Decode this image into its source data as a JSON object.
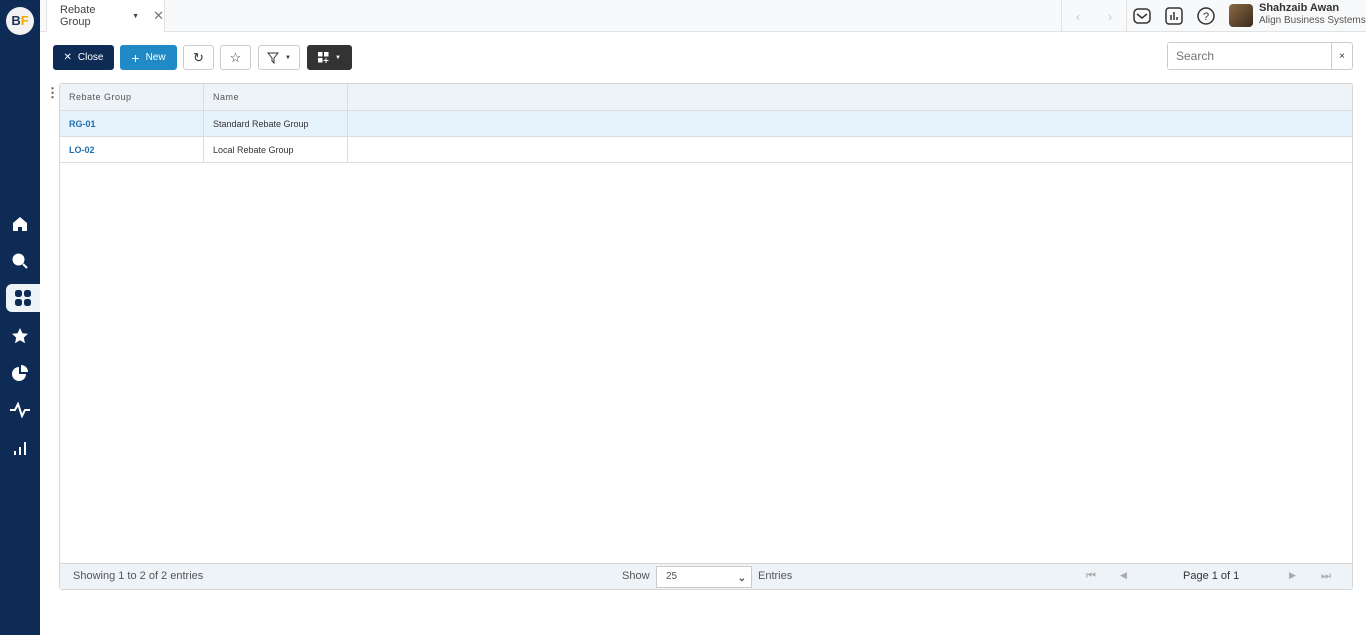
{
  "app": {
    "logo": "BF"
  },
  "sidebar": {
    "items": [
      {
        "icon": "home-icon"
      },
      {
        "icon": "search-icon"
      },
      {
        "icon": "apps-icon",
        "active": true
      },
      {
        "icon": "star-icon"
      },
      {
        "icon": "pie-chart-icon"
      },
      {
        "icon": "activity-icon"
      },
      {
        "icon": "bar-chart-icon"
      }
    ]
  },
  "tab": {
    "label": "Rebate Group"
  },
  "user": {
    "name": "Shahzaib Awan",
    "company": "Align Business Systems"
  },
  "toolbar": {
    "close": "Close",
    "new": "New"
  },
  "search": {
    "placeholder": "Search",
    "clear": "×"
  },
  "table": {
    "columns": [
      "Rebate Group",
      "Name"
    ],
    "rows": [
      {
        "code": "RG-01",
        "name": "Standard Rebate Group"
      },
      {
        "code": "LO-02",
        "name": "Local Rebate Group"
      }
    ]
  },
  "footer": {
    "summary": "Showing 1 to 2 of 2 entries",
    "show": "Show",
    "page_size": "25",
    "entries": "Entries",
    "page": "Page 1 of 1"
  }
}
